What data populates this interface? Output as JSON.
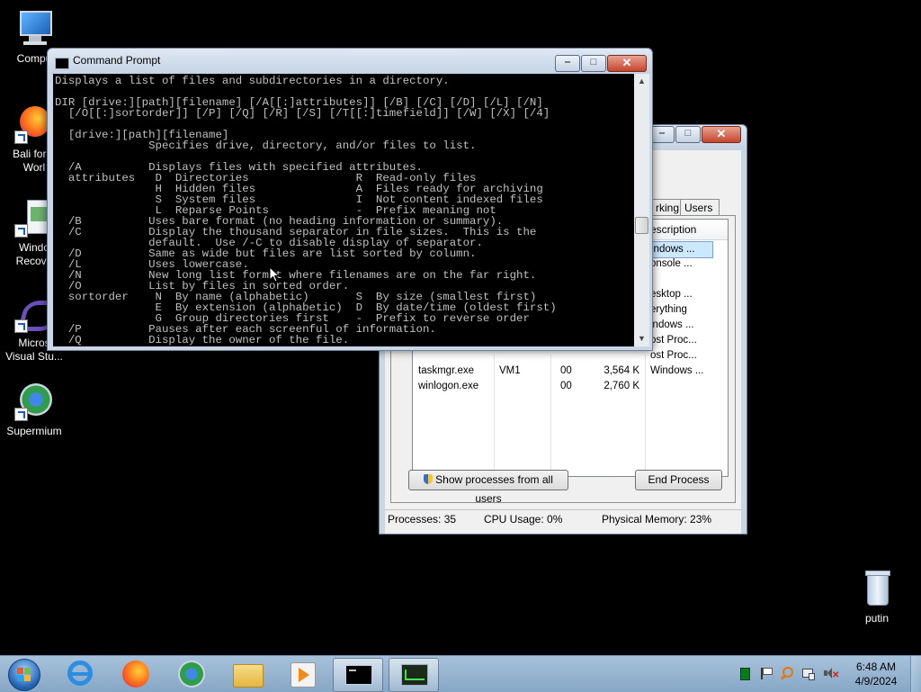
{
  "desktop": {
    "icons": [
      {
        "label": "Compu"
      },
      {
        "label": "Bali for T\nWorl"
      },
      {
        "label": "Windo\nRecove"
      },
      {
        "label": "Micros\nVisual Stu..."
      },
      {
        "label": "Supermium"
      },
      {
        "label": "putin"
      }
    ]
  },
  "cmd": {
    "title": "Command Prompt",
    "lines": [
      "Displays a list of files and subdirectories in a directory.",
      "",
      "DIR [drive:][path][filename] [/A[[:]attributes]] [/B] [/C] [/D] [/L] [/N]",
      "  [/O[[:]sortorder]] [/P] [/Q] [/R] [/S] [/T[[:]timefield]] [/W] [/X] [/4]",
      "",
      "  [drive:][path][filename]",
      "              Specifies drive, directory, and/or files to list.",
      "",
      "  /A          Displays files with specified attributes.",
      "  attributes   D  Directories                R  Read-only files",
      "               H  Hidden files               A  Files ready for archiving",
      "               S  System files               I  Not content indexed files",
      "               L  Reparse Points             -  Prefix meaning not",
      "  /B          Uses bare format (no heading information or summary).",
      "  /C          Display the thousand separator in file sizes.  This is the",
      "              default.  Use /-C to disable display of separator.",
      "  /D          Same as wide but files are list sorted by column.",
      "  /L          Uses lowercase.",
      "  /N          New long list format where filenames are on the far right.",
      "  /O          List by files in sorted order.",
      "  sortorder    N  By name (alphabetic)       S  By size (smallest first)",
      "               E  By extension (alphabetic)  D  By date/time (oldest first)",
      "               G  Group directories first    -  Prefix to reverse order",
      "  /P          Pauses after each screenful of information.",
      "  /Q          Display the owner of the file."
    ]
  },
  "taskmgr": {
    "tabs": {
      "networking": "rking",
      "users": "Users"
    },
    "columns": {
      "description": "escription"
    },
    "partial_desc": [
      "indows ...",
      "onsole ...",
      "",
      "esktop ...",
      "erything",
      "indows ...",
      "ost Proc...",
      "ost Proc..."
    ],
    "rows": [
      {
        "name": "taskmgr.exe",
        "user": "VM1",
        "cpu": "00",
        "mem": "3,564 K",
        "desc": "Windows ..."
      },
      {
        "name": "winlogon.exe",
        "user": "",
        "cpu": "00",
        "mem": "2,760 K",
        "desc": ""
      }
    ],
    "show_all_label": "Show processes from all users",
    "end_process_label": "End Process",
    "status": {
      "processes": "Processes: 35",
      "cpu": "CPU Usage: 0%",
      "memory": "Physical Memory: 23%"
    }
  },
  "clock": {
    "time": "6:48 AM",
    "date": "4/9/2024"
  },
  "colors": {
    "selection": "#cce8ff",
    "accent": "#1d5bbf"
  }
}
